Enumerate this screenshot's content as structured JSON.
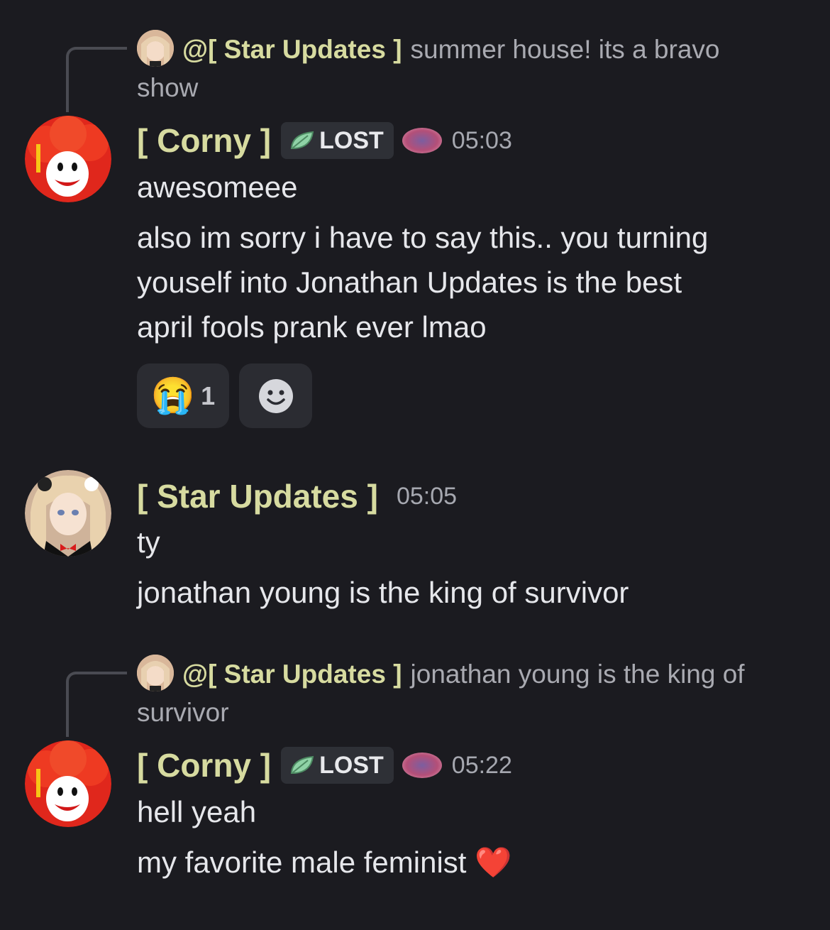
{
  "messages": [
    {
      "reply": {
        "name": "@[ Star Updates ]",
        "text_line1": "summer house! its a bravo",
        "text_line2": "show"
      },
      "author": "[ Corny ]",
      "tag": "LOST",
      "time": "05:03",
      "lines": [
        "awesomeee",
        "also im sorry i have to say this.. you turning",
        "youself into Jonathan Updates is the best",
        "april fools prank ever lmao"
      ],
      "reaction": {
        "emoji": "😭",
        "count": "1"
      }
    },
    {
      "author": "[ Star Updates ]",
      "time": "05:05",
      "lines": [
        "ty",
        "jonathan young is the king of survivor"
      ]
    },
    {
      "reply": {
        "name": "@[ Star Updates ]",
        "text_line1": "jonathan young is the king of",
        "text_line2": "survivor"
      },
      "author": "[ Corny ]",
      "tag": "LOST",
      "time": "05:22",
      "lines": [
        "hell yeah",
        "my favorite male feminist ❤️"
      ]
    }
  ],
  "colors": {
    "background": "#1b1b20",
    "username": "#d7dba0",
    "text": "#e6e7eb",
    "muted": "#a9aab1"
  }
}
